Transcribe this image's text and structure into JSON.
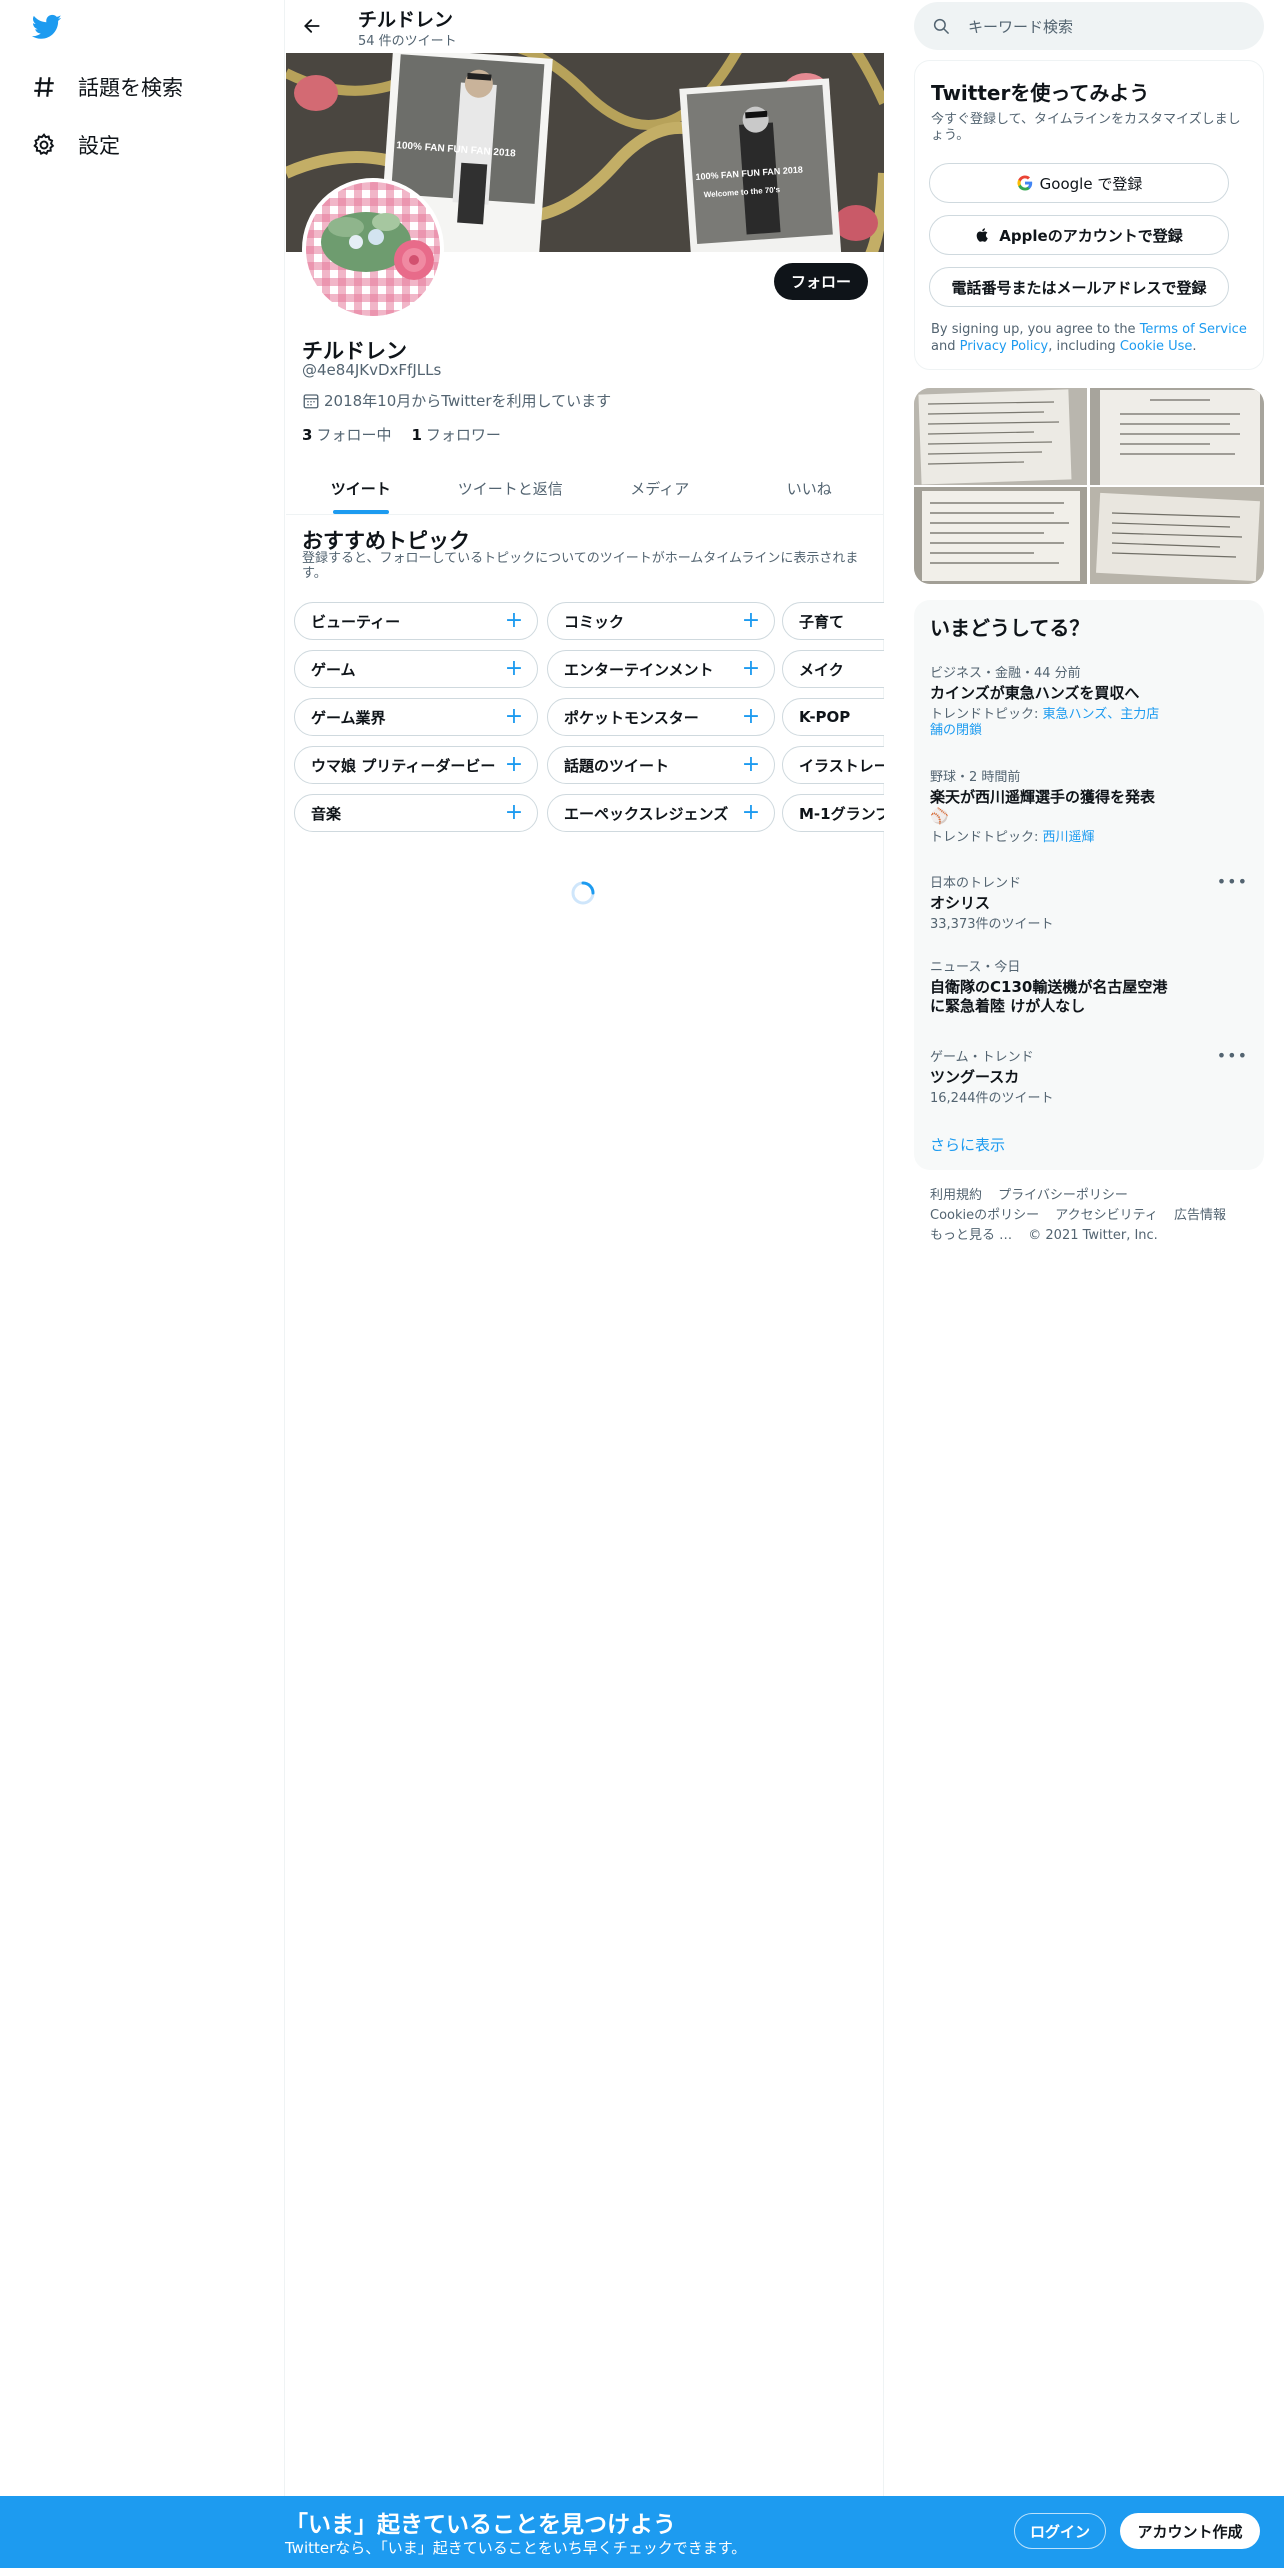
{
  "nav": {
    "items": [
      {
        "label": "話題を検索",
        "icon": "hashtag-icon"
      },
      {
        "label": "設定",
        "icon": "gear-icon"
      }
    ]
  },
  "header": {
    "name": "チルドレン",
    "tweet_count": "54 件のツイート"
  },
  "banner": {
    "poster_text_left": "100% FAN FUN FAN 2018",
    "poster_text_right": "100% FAN FUN FAN 2018",
    "poster_sub_right": "Welcome to the 70's"
  },
  "profile": {
    "follow_label": "フォロー",
    "name": "チルドレン",
    "handle": "@4e84JKvDxFfJLLs",
    "joined": "2018年10月からTwitterを利用しています",
    "following_count": "3",
    "following_label": "フォロー中",
    "followers_count": "1",
    "followers_label": "フォロワー"
  },
  "tabs": [
    "ツイート",
    "ツイートと返信",
    "メディア",
    "いいね"
  ],
  "topics": {
    "title": "おすすめトピック",
    "subtitle": "登録すると、フォローしているトピックについてのツイートがホームタイムラインに表示されます。",
    "chips": [
      [
        "ビューティー",
        "コミック",
        "子育て"
      ],
      [
        "ゲーム",
        "エンターテインメント",
        "メイク"
      ],
      [
        "ゲーム業界",
        "ポケットモンスター",
        "K-POP"
      ],
      [
        "ウマ娘 プリティーダービー",
        "話題のツイート",
        "イラストレー"
      ],
      [
        "音楽",
        "エーペックスレジェンズ",
        "M-1グランプ"
      ]
    ]
  },
  "search": {
    "placeholder": "キーワード検索"
  },
  "signup": {
    "title": "Twitterを使ってみよう",
    "subtitle": "今すぐ登録して、タイムラインをカスタマイズしましょう。",
    "google": "Google で登録",
    "apple": "Appleのアカウントで登録",
    "phone": "電話番号またはメールアドレスで登録",
    "terms_prefix": "By signing up, you agree to the",
    "terms_tos": "Terms of Service",
    "terms_and": "and",
    "terms_privacy": "Privacy Policy",
    "terms_including": ", including",
    "terms_cookie": "Cookie Use",
    "terms_end": "."
  },
  "trends": {
    "title": "いまどうしてる？",
    "items": [
      {
        "meta": "ビジネス・金融・44 分前",
        "name": "カインズが東急ハンズを買収へ",
        "extra_label": "トレンドトピック: ",
        "extra_link": "東急ハンズ、主力店舗の閉鎖"
      },
      {
        "meta": "野球・2 時間前",
        "name": "楽天が西川遥輝選手の獲得を発表 ⚾",
        "extra_label": "トレンドトピック: ",
        "extra_link": "西川遥輝"
      },
      {
        "meta": "日本のトレンド",
        "name": "オシリス",
        "extra_label": "33,373件のツイート"
      },
      {
        "meta": "ニュース・今日",
        "name": "自衛隊のC130輸送機が名古屋空港に緊急着陸 けが人なし"
      },
      {
        "meta": "ゲーム・トレンド",
        "name": "ツングースカ",
        "extra_label": "16,244件のツイート"
      }
    ],
    "show_more": "さらに表示"
  },
  "footer": {
    "links": [
      "利用規約",
      "プライバシーポリシー",
      "Cookieのポリシー",
      "アクセシビリティ",
      "広告情報",
      "もっと見る …",
      "© 2021 Twitter, Inc."
    ]
  },
  "bottom_bar": {
    "title": "「いま」起きていることを見つけよう",
    "subtitle": "Twitterなら、「いま」起きていることをいち早くチェックできます。",
    "login": "ログイン",
    "signup": "アカウント作成"
  },
  "colors": {
    "accent": "#1d9bf0",
    "text": "#0f1419",
    "muted": "#536471",
    "border": "#eff3f4"
  }
}
